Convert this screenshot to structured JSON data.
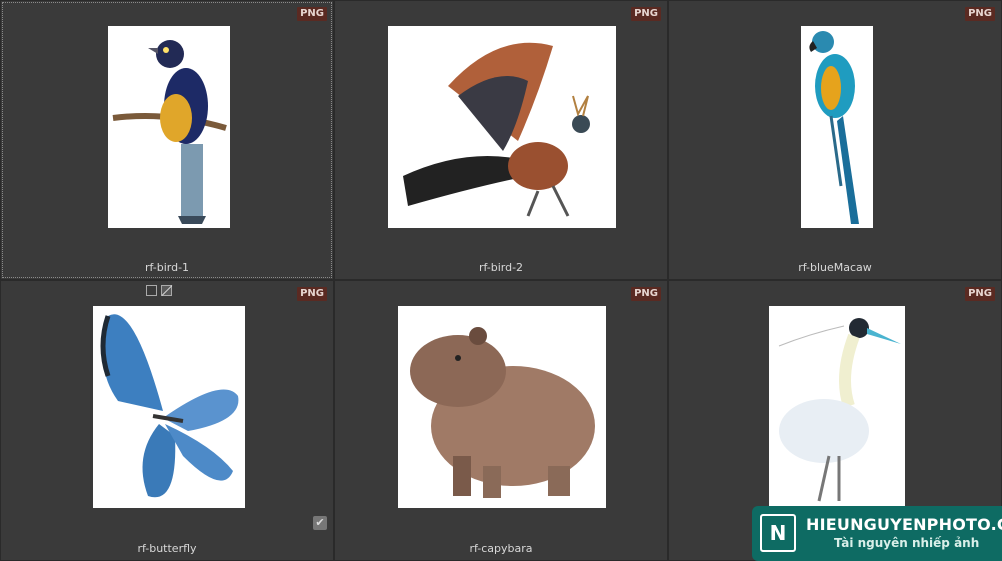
{
  "items": [
    {
      "label": "rf-bird-1",
      "badge": "PNG"
    },
    {
      "label": "rf-bird-2",
      "badge": "PNG"
    },
    {
      "label": "rf-blueMacaw",
      "badge": "PNG"
    },
    {
      "label": "rf-butterfly",
      "badge": "PNG"
    },
    {
      "label": "rf-capybara",
      "badge": "PNG"
    },
    {
      "label": "",
      "badge": "PNG"
    }
  ],
  "watermark": {
    "title": "HIEUNGUYENPHOTO.COM",
    "subtitle": "Tài nguyên nhiếp ảnh"
  },
  "colors": {
    "cell_bg": "#3a3a3a",
    "badge_bg": "#5a2a22",
    "watermark_bg": "#0e6b63"
  },
  "icons": [
    "frame-icon",
    "slash-square-icon",
    "checkmark-icon"
  ]
}
